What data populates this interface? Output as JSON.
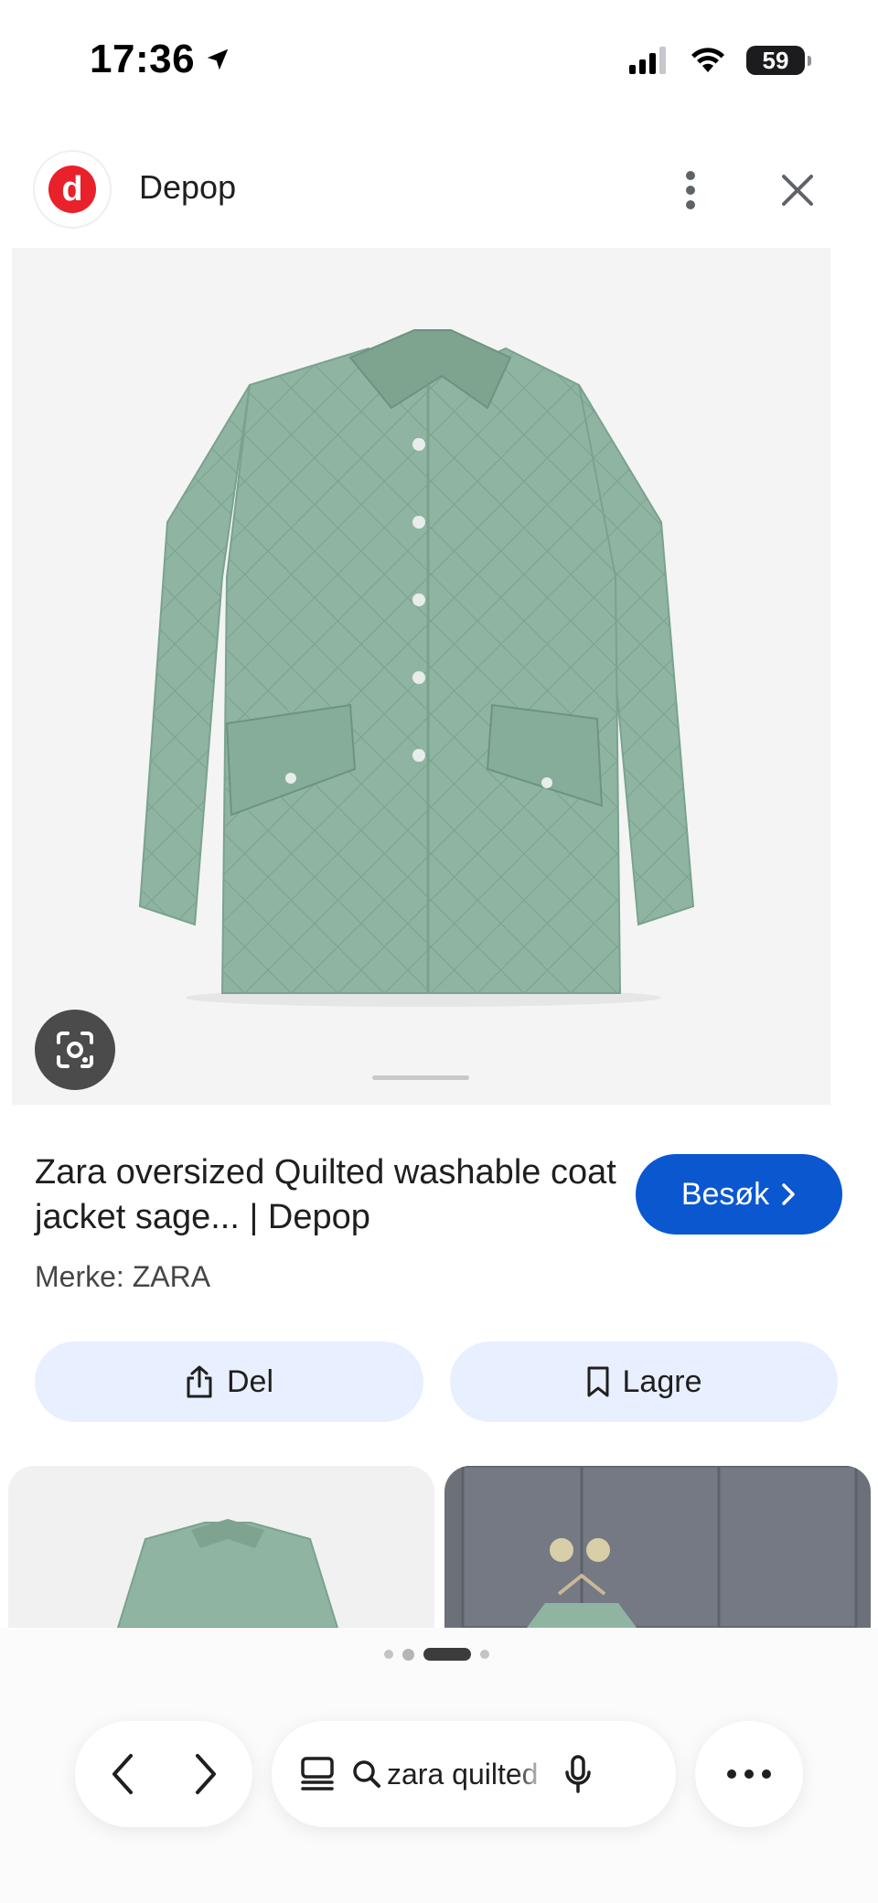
{
  "status_bar": {
    "time": "17:36",
    "battery": "59",
    "icons": [
      "location-arrow-icon",
      "cellular-signal-icon",
      "wifi-icon",
      "battery-icon"
    ]
  },
  "header": {
    "site_logo_letter": "d",
    "site_name": "Depop",
    "icons": [
      "more-vertical-icon",
      "close-icon"
    ]
  },
  "product": {
    "title": "Zara oversized Quilted washable coat jacket sage... | Depop",
    "brand_line": "Merke: ZARA",
    "visit_label": "Besøk",
    "icons": [
      "lens-icon",
      "chevron-right-icon"
    ]
  },
  "actions": {
    "share_label": "Del",
    "save_label": "Lagre",
    "icons": [
      "share-icon",
      "bookmark-icon"
    ]
  },
  "toolbar": {
    "url_text": "zara quilted",
    "icons": [
      "back-icon",
      "forward-icon",
      "tabs-icon",
      "search-icon",
      "mic-icon",
      "more-horizontal-icon"
    ]
  },
  "colors": {
    "accent_blue": "#0b57d0",
    "action_bg": "#e8efff",
    "depop_red": "#e8212a",
    "jacket_green": "#8fb5a2"
  }
}
